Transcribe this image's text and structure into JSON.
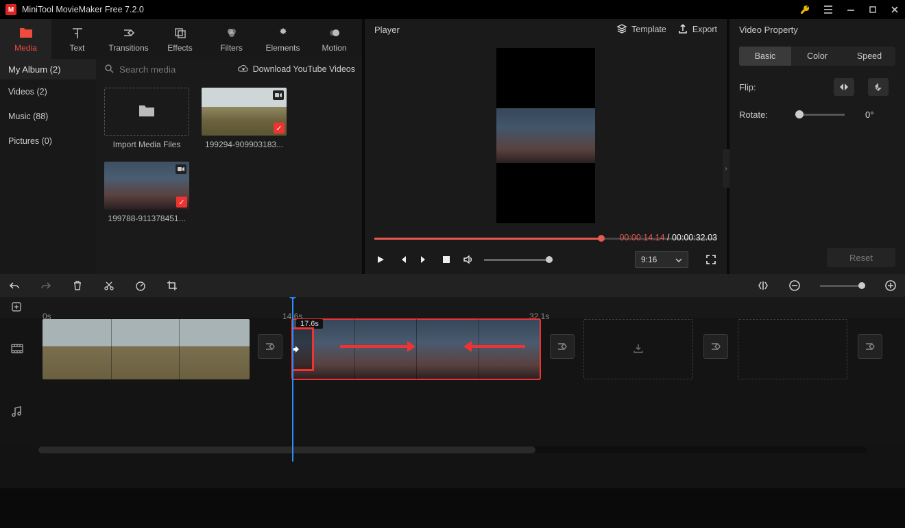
{
  "titlebar": {
    "title": "MiniTool MovieMaker Free 7.2.0"
  },
  "main_toolbar": [
    {
      "id": "media",
      "label": "Media",
      "active": true
    },
    {
      "id": "text",
      "label": "Text"
    },
    {
      "id": "transitions",
      "label": "Transitions"
    },
    {
      "id": "effects",
      "label": "Effects"
    },
    {
      "id": "filters",
      "label": "Filters"
    },
    {
      "id": "elements",
      "label": "Elements"
    },
    {
      "id": "motion",
      "label": "Motion"
    }
  ],
  "media": {
    "album_title": "My Album (2)",
    "search_placeholder": "Search media",
    "download_label": "Download YouTube Videos",
    "sidebar": [
      {
        "label": "Videos (2)"
      },
      {
        "label": "Music (88)"
      },
      {
        "label": "Pictures (0)"
      }
    ],
    "import_label": "Import Media Files",
    "items": [
      {
        "caption": "199294-909903183..."
      },
      {
        "caption": "199788-911378451..."
      }
    ]
  },
  "player": {
    "title": "Player",
    "template_label": "Template",
    "export_label": "Export",
    "current_time": "00:00:14.14",
    "duration": "00:00:32.03",
    "ratio": "9:16"
  },
  "property": {
    "title": "Video Property",
    "tabs": {
      "basic": "Basic",
      "color": "Color",
      "speed": "Speed"
    },
    "flip_label": "Flip:",
    "rotate_label": "Rotate:",
    "rotate_value": "0°",
    "reset_label": "Reset"
  },
  "timeline": {
    "marks": {
      "m0": "0s",
      "m1": "14.6s",
      "m2": "32.1s"
    },
    "trim_label": "17.6s"
  }
}
